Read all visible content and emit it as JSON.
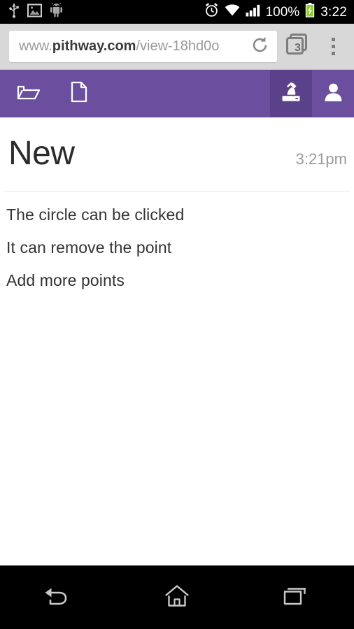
{
  "status_bar": {
    "left_icons": [
      "usb-icon",
      "screenshot-image-icon",
      "android-robot-icon"
    ],
    "alarm_icon": "alarm-clock-icon",
    "wifi_icon": "wifi-icon",
    "signal_icon": "cellular-signal-icon",
    "battery_percent": "100%",
    "battery_icon": "battery-charging-icon",
    "clock": "3:22",
    "background_color": "#000000",
    "text_color": "#ffffff"
  },
  "browser": {
    "url_prefix": "www.",
    "url_host": "pithway.com",
    "url_path": "/view-18hd0o",
    "url_full": "www.pithway.com/view-18hd0o",
    "reload_icon": "reload-icon",
    "tabs_icon": "tabs-stack-icon",
    "tab_count": "3",
    "menu_icon": "overflow-menu-icon",
    "bar_color": "#d8d8d8",
    "field_color": "#ffffff"
  },
  "app_toolbar": {
    "background_color": "#6b4f9e",
    "active_color": "#5b4189",
    "items": [
      {
        "icon": "open-folder-icon",
        "label": "Open",
        "active": false
      },
      {
        "icon": "new-document-icon",
        "label": "New",
        "active": false
      },
      {
        "icon": "microscope-icon",
        "label": "Experiment",
        "active": true
      },
      {
        "icon": "user-account-icon",
        "label": "Account",
        "active": false
      }
    ]
  },
  "note": {
    "title": "New",
    "timestamp": "3:21pm",
    "lines": [
      "The circle can be clicked",
      "It can remove the point",
      "Add more points"
    ]
  },
  "nav_bar": {
    "background_color": "#000000",
    "buttons": [
      {
        "icon": "back-icon",
        "label": "Back"
      },
      {
        "icon": "home-icon",
        "label": "Home"
      },
      {
        "icon": "recents-icon",
        "label": "Recent apps"
      }
    ]
  }
}
